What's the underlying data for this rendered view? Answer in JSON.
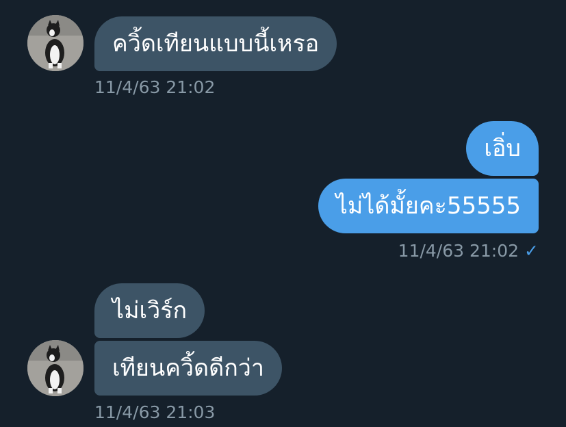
{
  "conversation": {
    "group1": {
      "messages": [
        "ควิ้ดเทียนแบบนี้เหรอ"
      ],
      "timestamp": "11/4/63 21:02"
    },
    "group2": {
      "messages": [
        "เอิ่บ",
        "ไม่ได้มั้ยคะ55555"
      ],
      "timestamp": "11/4/63 21:02",
      "status_icon": "check-icon",
      "status_glyph": "✓"
    },
    "group3": {
      "messages": [
        "ไม่เวิร์ก",
        "เทียนควิ้ดดีกว่า"
      ],
      "timestamp": "11/4/63 21:03"
    }
  },
  "colors": {
    "background": "#15202b",
    "received_bubble": "#3d5466",
    "sent_bubble": "#4a9ee8",
    "timestamp_text": "#8899a6",
    "check": "#4a9ee8"
  }
}
